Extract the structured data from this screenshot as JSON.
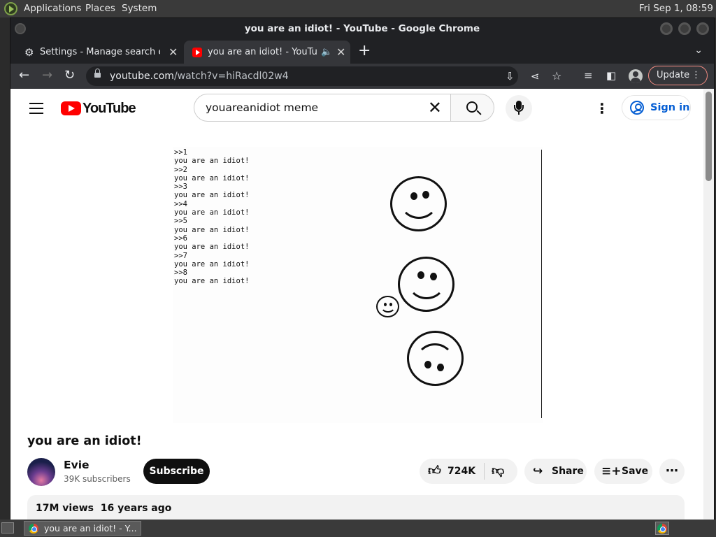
{
  "desktop": {
    "menus": [
      "Applications",
      "Places",
      "System"
    ],
    "clock": "Fri Sep  1, 08:59",
    "taskbar_item": "you are an idiot! - Y..."
  },
  "browser": {
    "window_title": "you are an idiot! - YouTube - Google Chrome",
    "tabs": [
      {
        "label": "Settings - Manage search engi",
        "icon": "gear-icon"
      },
      {
        "label": "you are an idiot! - YouTube",
        "icon": "youtube-icon",
        "audio": true
      }
    ],
    "url_host": "youtube.com",
    "url_path": "/watch?v=hiRacdl02w4",
    "update_label": "Update"
  },
  "youtube": {
    "logo_text": "YouTube",
    "search_query": "youareanidiot meme",
    "signin_label": "Sign in",
    "video": {
      "console_lines": [
        ">>1",
        "you are an idiot!",
        ">>2",
        "you are an idiot!",
        ">>3",
        "you are an idiot!",
        ">>4",
        "you are an idiot!",
        ">>5",
        "you are an idiot!",
        ">>6",
        "you are an idiot!",
        ">>7",
        "you are an idiot!",
        ">>8",
        "you are an idiot!"
      ],
      "title": "you are an idiot!",
      "channel": "Evie",
      "subscribers": "39K subscribers",
      "subscribe_label": "Subscribe",
      "likes": "724K",
      "share_label": "Share",
      "save_label": "Save",
      "views": "17M views",
      "age": "16 years ago"
    }
  }
}
